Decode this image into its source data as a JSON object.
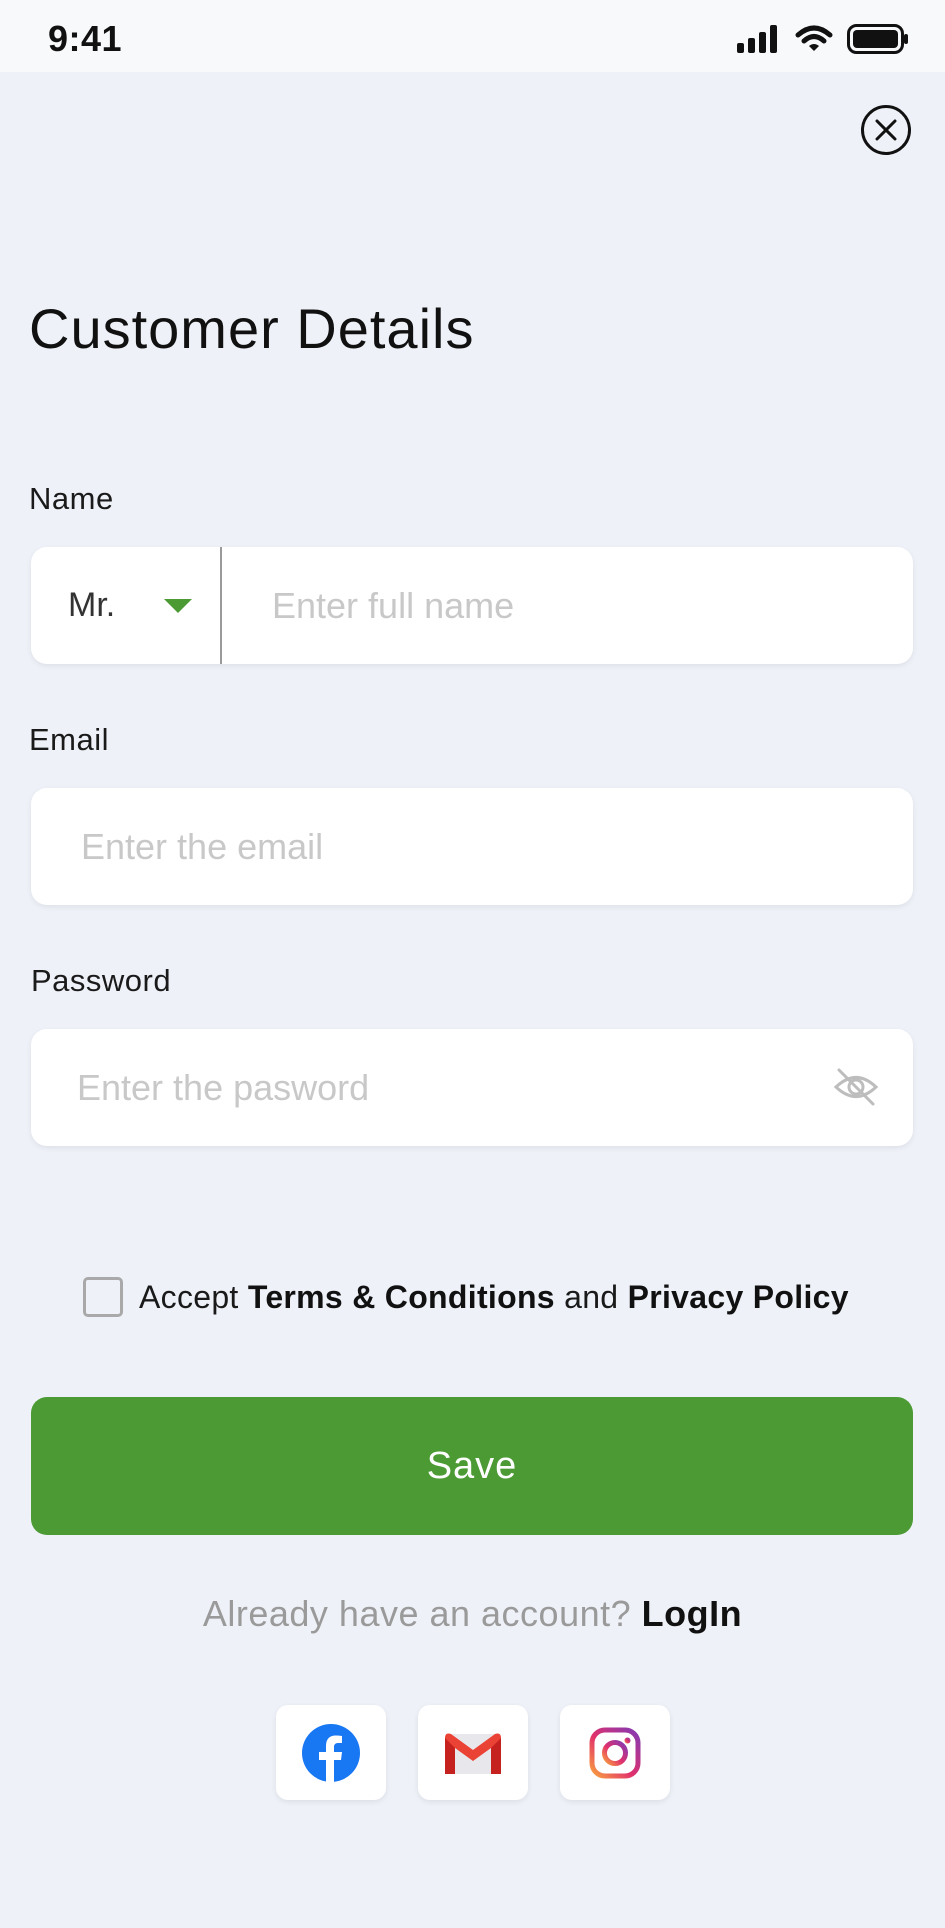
{
  "status_bar": {
    "time": "9:41",
    "icons": [
      "signal-icon",
      "wifi-icon",
      "battery-icon"
    ]
  },
  "page": {
    "title": "Customer Details",
    "close_icon": "close-circle-icon"
  },
  "form": {
    "name": {
      "label": "Name",
      "salutation": "Mr.",
      "placeholder": "Enter full name",
      "value": ""
    },
    "email": {
      "label": "Email",
      "placeholder": "Enter the email",
      "value": ""
    },
    "password": {
      "label": "Password",
      "placeholder": "Enter the pasword",
      "value": "",
      "toggle_icon": "eye-off-icon"
    },
    "terms": {
      "prefix": "Accept",
      "terms_link": "Terms & Conditions",
      "conjunction": "and",
      "privacy_link": "Privacy Policy",
      "checked": false
    },
    "save_label": "Save"
  },
  "login": {
    "prompt": "Already have an account?",
    "link": "LogIn"
  },
  "social": [
    {
      "name": "facebook",
      "icon": "facebook-icon"
    },
    {
      "name": "gmail",
      "icon": "gmail-icon"
    },
    {
      "name": "instagram",
      "icon": "instagram-icon"
    }
  ],
  "colors": {
    "background": "#eef2f8",
    "accent": "#4c9a34",
    "facebook": "#1877f2",
    "gmail_red": "#ea4335"
  }
}
